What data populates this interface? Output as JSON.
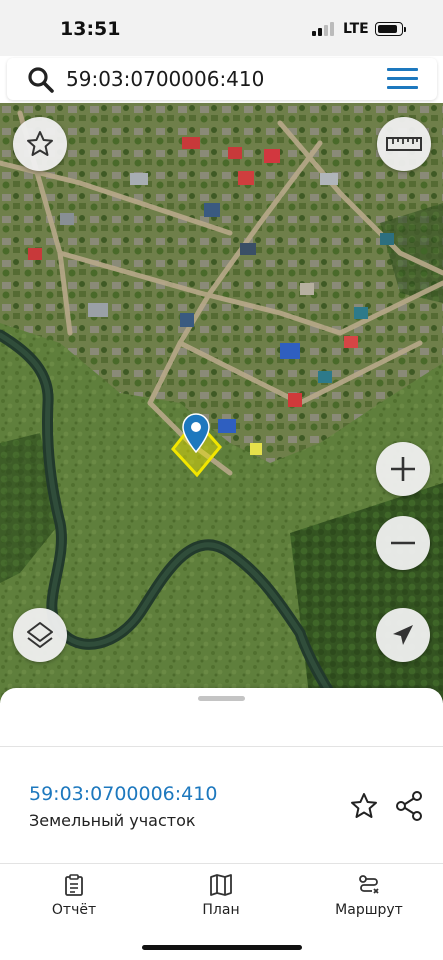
{
  "status_bar": {
    "time": "13:51",
    "network": "LTE"
  },
  "search": {
    "query": "59:03:0700006:410",
    "search_icon": "search-icon",
    "menu_icon": "hamburger-menu-icon"
  },
  "map": {
    "type": "satellite",
    "controls": {
      "favorite": "star-icon",
      "ruler": "ruler-icon",
      "zoom_in": "plus-icon",
      "zoom_out": "minus-icon",
      "layers": "layers-icon",
      "locate": "navigation-arrow-icon"
    },
    "marker_icon": "location-pin-icon",
    "parcel_highlight_color": "#f2e600"
  },
  "parcel": {
    "cadastral_number": "59:03:0700006:410",
    "type": "Земельный участок"
  },
  "tabs": [
    {
      "label": "Отчёт",
      "icon": "report-clipboard-icon"
    },
    {
      "label": "План",
      "icon": "map-plan-icon"
    },
    {
      "label": "Маршрут",
      "icon": "route-icon"
    }
  ],
  "colors": {
    "accent": "#1d78be",
    "text": "#222222"
  }
}
